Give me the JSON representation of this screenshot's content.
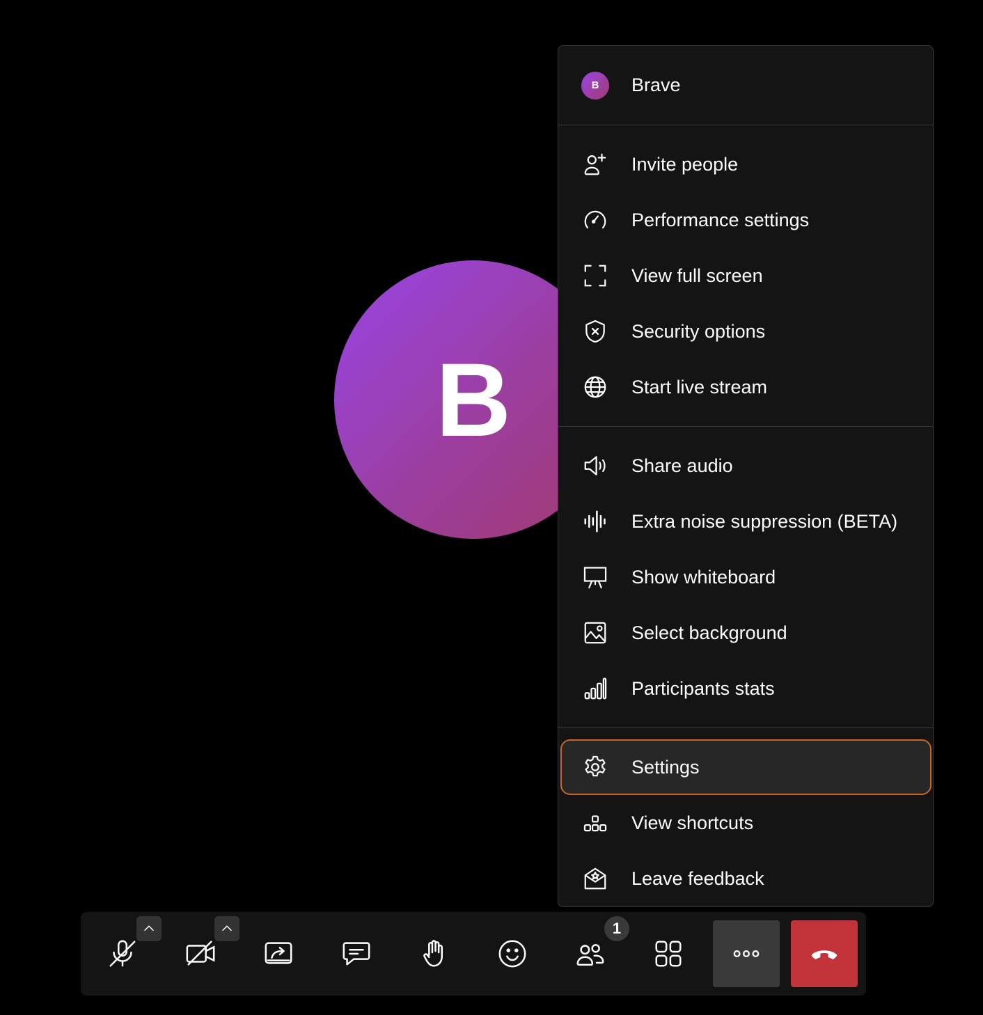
{
  "participant": {
    "initial": "B"
  },
  "menu": {
    "user": {
      "initial": "B",
      "name": "Brave"
    },
    "sections": [
      [
        {
          "label": "Invite people",
          "icon": "invite-people-icon"
        },
        {
          "label": "Performance settings",
          "icon": "speedometer-icon"
        },
        {
          "label": "View full screen",
          "icon": "fullscreen-icon"
        },
        {
          "label": "Security options",
          "icon": "shield-icon"
        },
        {
          "label": "Start live stream",
          "icon": "globe-icon"
        }
      ],
      [
        {
          "label": "Share audio",
          "icon": "speaker-icon"
        },
        {
          "label": "Extra noise suppression (BETA)",
          "icon": "waveform-icon"
        },
        {
          "label": "Show whiteboard",
          "icon": "whiteboard-icon"
        },
        {
          "label": "Select background",
          "icon": "image-icon"
        },
        {
          "label": "Participants stats",
          "icon": "bar-chart-icon"
        }
      ],
      [
        {
          "label": "Settings",
          "icon": "gear-icon",
          "selected": true
        },
        {
          "label": "View shortcuts",
          "icon": "shortcuts-icon"
        },
        {
          "label": "Leave feedback",
          "icon": "feedback-icon"
        }
      ]
    ]
  },
  "toolbar": {
    "participants_count": "1",
    "buttons": [
      "microphone-muted-icon",
      "camera-off-icon",
      "screen-share-icon",
      "chat-icon",
      "raise-hand-icon",
      "reactions-icon",
      "participants-icon",
      "tile-view-icon",
      "more-icon",
      "hangup-icon"
    ]
  },
  "colors": {
    "highlight_border": "#c8652e",
    "hangup": "#c0343a",
    "avatar_start": "#9a45e8",
    "avatar_end": "#a23a6e"
  }
}
